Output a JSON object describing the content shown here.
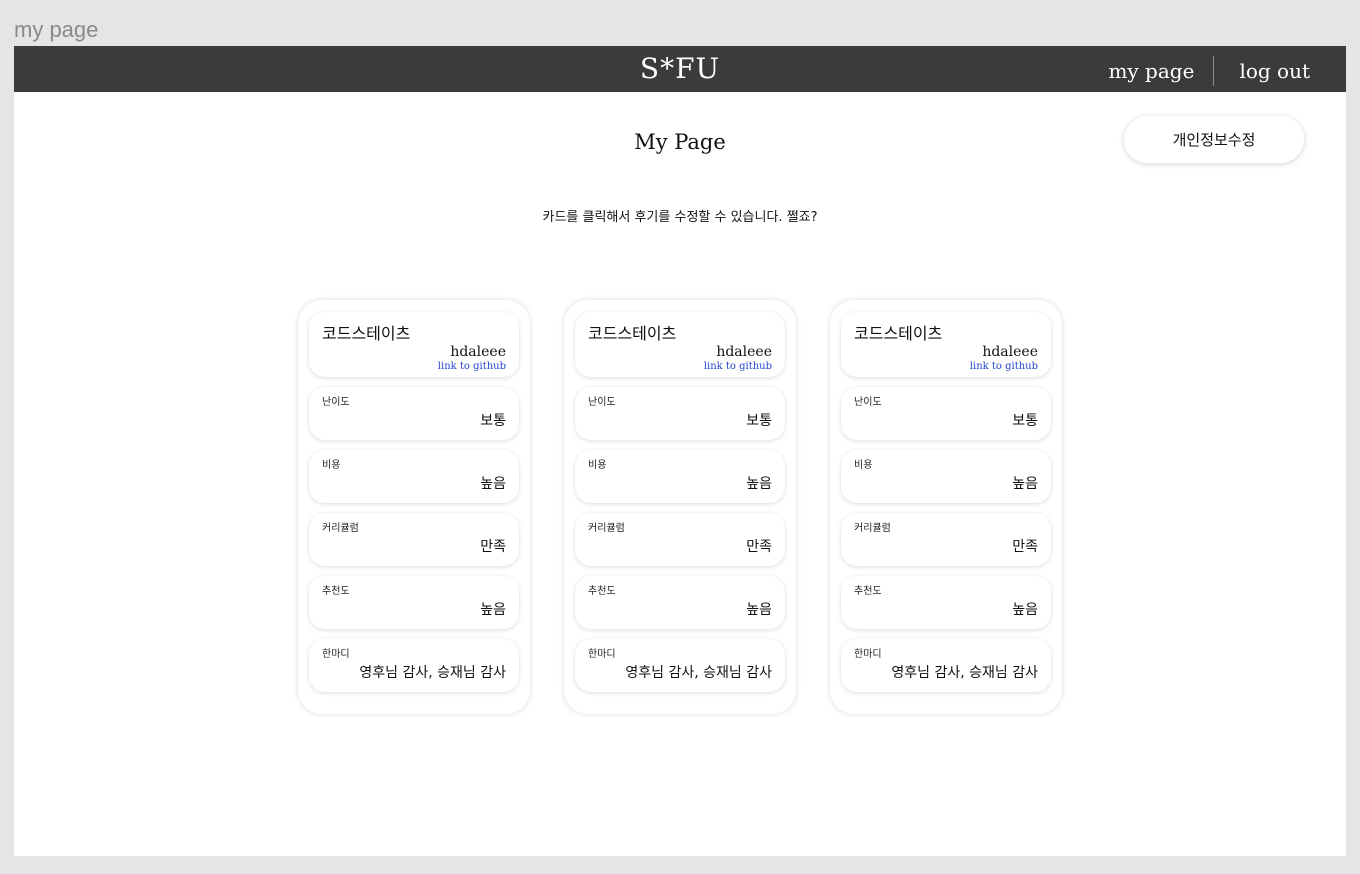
{
  "frame_label": "my page",
  "header": {
    "brand": "S*FU",
    "nav": [
      {
        "label": "my page"
      },
      {
        "label": "log out"
      }
    ]
  },
  "main": {
    "title": "My Page",
    "edit_profile_label": "개인정보수정",
    "subtitle": "카드를 클릭해서 후기를 수정할 수 있습니다. 쩔죠?"
  },
  "cards": [
    {
      "school": "코드스테이츠",
      "username": "hdaleee",
      "github_link": "link to github",
      "rows": [
        {
          "label": "난이도",
          "value": "보통"
        },
        {
          "label": "비용",
          "value": "높음"
        },
        {
          "label": "커리큘럼",
          "value": "만족"
        },
        {
          "label": "추천도",
          "value": "높음"
        },
        {
          "label": "한마디",
          "value": "영후님 감사, 승재님 감사"
        }
      ]
    },
    {
      "school": "코드스테이츠",
      "username": "hdaleee",
      "github_link": "link to github",
      "rows": [
        {
          "label": "난이도",
          "value": "보통"
        },
        {
          "label": "비용",
          "value": "높음"
        },
        {
          "label": "커리큘럼",
          "value": "만족"
        },
        {
          "label": "추천도",
          "value": "높음"
        },
        {
          "label": "한마디",
          "value": "영후님 감사, 승재님 감사"
        }
      ]
    },
    {
      "school": "코드스테이츠",
      "username": "hdaleee",
      "github_link": "link to github",
      "rows": [
        {
          "label": "난이도",
          "value": "보통"
        },
        {
          "label": "비용",
          "value": "높음"
        },
        {
          "label": "커리큘럼",
          "value": "만족"
        },
        {
          "label": "추천도",
          "value": "높음"
        },
        {
          "label": "한마디",
          "value": "영후님 감사, 승재님 감사"
        }
      ]
    }
  ],
  "colors": {
    "header_bg": "#3b3b3b",
    "link": "#2244cc",
    "page_bg": "#e5e5e5"
  }
}
